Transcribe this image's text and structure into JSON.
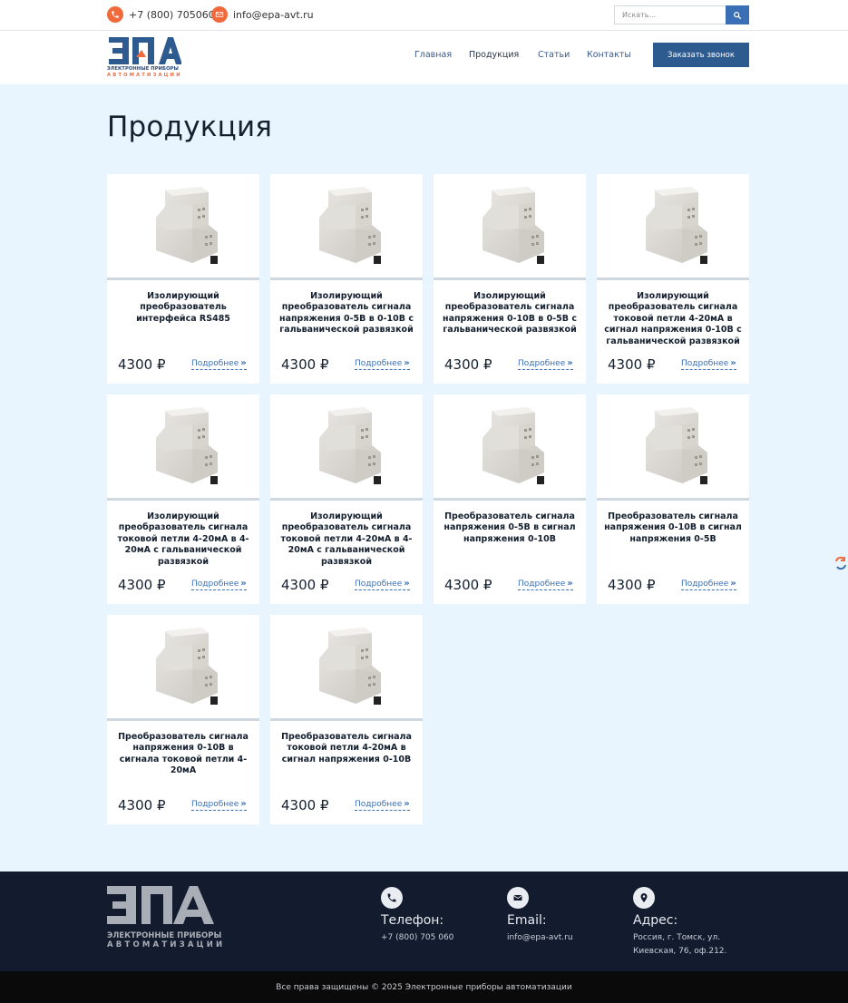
{
  "topbar": {
    "phone": "+7 (800) 705060",
    "email": "info@epa-avt.ru",
    "search_placeholder": "Искать..."
  },
  "header": {
    "logo_line1": "ЭЛЕКТРОННЫЕ ПРИБОРЫ",
    "logo_line2": "АВТОМАТИЗАЦИИ",
    "nav": [
      "Главная",
      "Продукция",
      "Статьи",
      "Контакты"
    ],
    "cta": "Заказать звонок"
  },
  "main": {
    "title": "Продукция",
    "products": [
      {
        "name": "Изолирующий преобразователь интерфейса RS485",
        "price": "4300 ₽",
        "more": "Подробнее"
      },
      {
        "name": "Изолирующий преобразователь сигнала напряжения 0-5В в 0-10В с гальванической развязкой",
        "price": "4300 ₽",
        "more": "Подробнее"
      },
      {
        "name": "Изолирующий преобразователь сигнала напряжения 0-10В в 0-5В с гальванической развязкой",
        "price": "4300 ₽",
        "more": "Подробнее"
      },
      {
        "name": "Изолирующий преобразователь сигнала токовой петли 4-20мА в сигнал напряжения 0-10В с гальванической развязкой",
        "price": "4300 ₽",
        "more": "Подробнее"
      },
      {
        "name": "Изолирующий преобразователь сигнала токовой петли 4-20мА в 4-20мА с гальванической развязкой",
        "price": "4300 ₽",
        "more": "Подробнее"
      },
      {
        "name": "Изолирующий преобразователь сигнала токовой петли 4-20мА в 4-20мА с гальванической развязкой",
        "price": "4300 ₽",
        "more": "Подробнее"
      },
      {
        "name": "Преобразователь сигнала напряжения 0-5В в сигнал напряжения 0-10В",
        "price": "4300 ₽",
        "more": "Подробнее"
      },
      {
        "name": "Преобразователь сигнала напряжения 0-10В в сигнал напряжения 0-5В",
        "price": "4300 ₽",
        "more": "Подробнее"
      },
      {
        "name": "Преобразователь сигнала напряжения 0-10В  в сигнала токовой петли 4-20мА",
        "price": "4300 ₽",
        "more": "Подробнее"
      },
      {
        "name": "Преобразователь сигнала токовой петли 4-20мА в сигнал напряжения 0-10В",
        "price": "4300 ₽",
        "more": "Подробнее"
      }
    ]
  },
  "footer": {
    "logo_line1": "ЭЛЕКТРОННЫЕ ПРИБОРЫ",
    "logo_line2": "АВТОМАТИЗАЦИИ",
    "phone_label": "Телефон:",
    "phone_value": "+7 (800) 705 060",
    "email_label": "Email:",
    "email_value": "info@epa-avt.ru",
    "address_label": "Адрес:",
    "address_value": "Россия, г. Томск, ул. Киевская, 76, оф.212.",
    "copyright": "Все права защищены © 2025 Электронные приборы автоматизации"
  },
  "colors": {
    "accent_orange": "#f06a3c",
    "brand_blue": "#2d5a8f",
    "page_bg": "#e8f5fe",
    "footer_bg": "#131c2e"
  }
}
